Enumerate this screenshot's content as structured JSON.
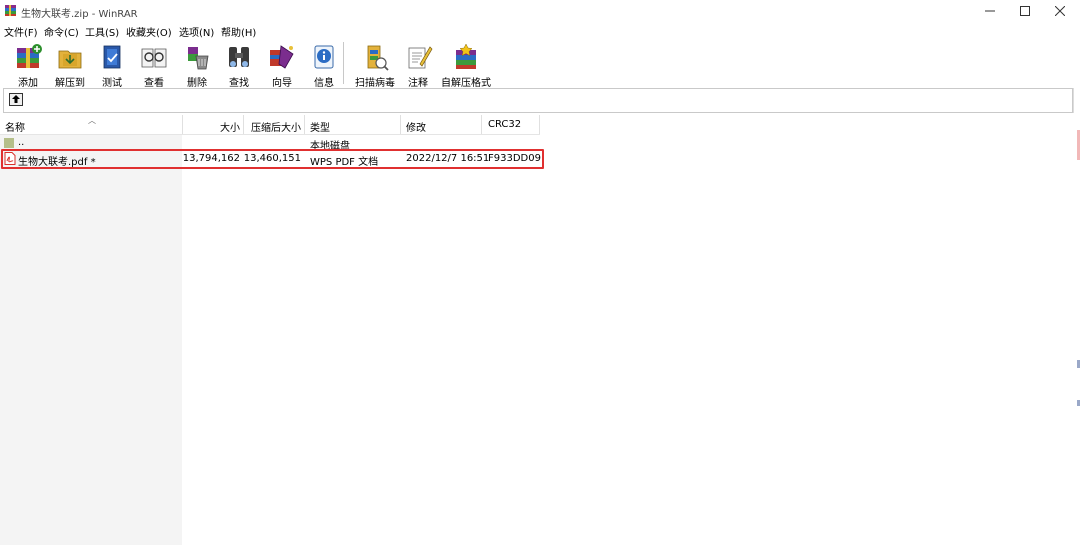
{
  "window": {
    "title": "生物大联考.zip - WinRAR",
    "icon": "winrar-icon"
  },
  "menu": [
    "文件(F)",
    "命令(C)",
    "工具(S)",
    "收藏夹(O)",
    "选项(N)",
    "帮助(H)"
  ],
  "toolbar": {
    "items": [
      {
        "label": "添加",
        "icon": "add-archive-icon"
      },
      {
        "label": "解压到",
        "icon": "extract-to-icon"
      },
      {
        "label": "测试",
        "icon": "test-icon"
      },
      {
        "label": "查看",
        "icon": "view-icon"
      },
      {
        "label": "删除",
        "icon": "delete-icon"
      },
      {
        "label": "查找",
        "icon": "find-icon"
      },
      {
        "label": "向导",
        "icon": "wizard-icon"
      },
      {
        "label": "信息",
        "icon": "info-icon"
      },
      {
        "label": "扫描病毒",
        "icon": "virus-scan-icon"
      },
      {
        "label": "注释",
        "icon": "comment-icon"
      },
      {
        "label": "自解压格式",
        "icon": "sfx-icon"
      }
    ]
  },
  "columns": [
    "名称",
    "大小",
    "压缩后大小",
    "类型",
    "修改",
    "CRC32"
  ],
  "rows": [
    {
      "name": "..",
      "size": "",
      "packed": "",
      "type": "本地磁盘",
      "modified": "",
      "crc": ""
    },
    {
      "name": "生物大联考.pdf *",
      "size": "13,794,162",
      "packed": "13,460,151",
      "type": "WPS PDF 文档",
      "modified": "2022/12/7 16:51",
      "crc": "F933DD09"
    }
  ],
  "colors": {
    "highlight": "#e03030",
    "pdf_icon": "#d9302b"
  }
}
